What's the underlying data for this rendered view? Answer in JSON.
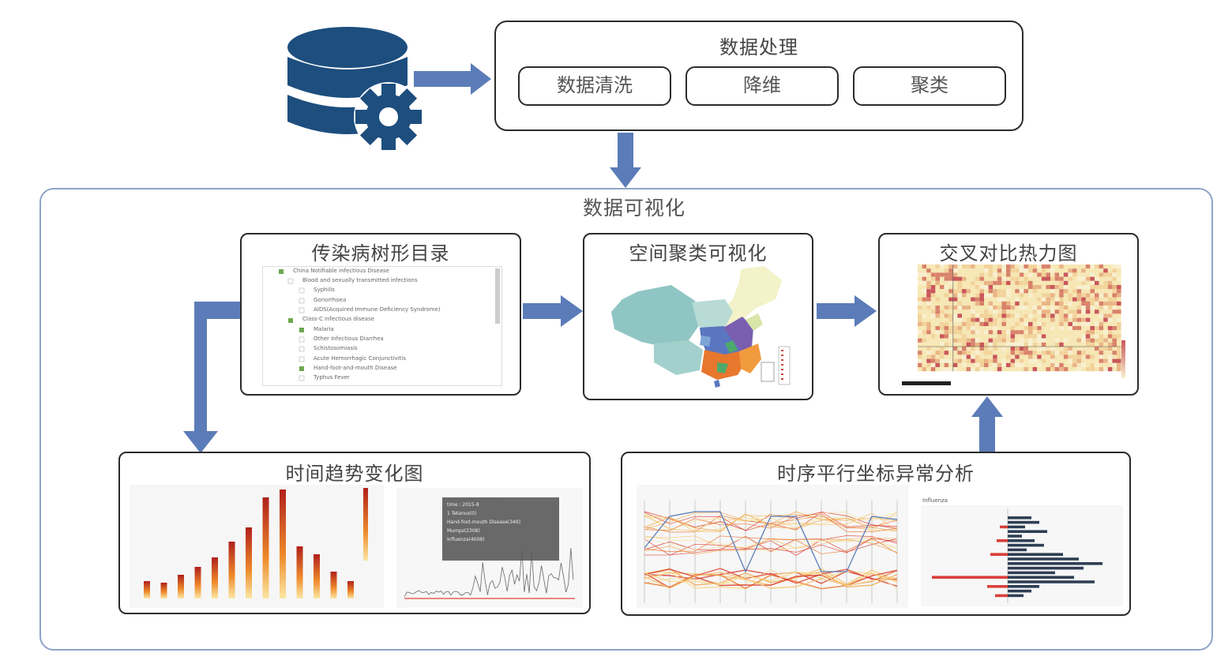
{
  "top": {
    "process_title": "数据处理",
    "steps": [
      "数据清洗",
      "降维",
      "聚类"
    ]
  },
  "visualization": {
    "title": "数据可视化",
    "panels": {
      "tree": "传染病树形目录",
      "map": "空间聚类可视化",
      "heatmap": "交叉对比热力图",
      "trend": "时间趋势变化图",
      "parallel": "时序平行坐标异常分析"
    }
  },
  "tree_items": [
    "China Notifiable Infectious Disease",
    "Blood and sexually transmitted infections",
    "Syphilis",
    "Gonorrhoea",
    "AIDS(Acquired Immune Deficiency Syndrome)",
    "Class-C infectious disease",
    "Malaria",
    "Other Infectious Diarrhea",
    "Schistosomiasis",
    "Acute Hemorrhagic Conjunctivitis",
    "Hand-foot-and-mouth Disease",
    "Typhus Fever"
  ],
  "tooltip": {
    "date": "time : 2015-8",
    "lines": [
      "1 Tetanus(0)",
      "Hand-foot-mouth Disease(349)",
      "Mumps(2308)",
      "Influenza(4008)"
    ]
  },
  "parallel_side_title": "Influenza",
  "colors": {
    "arrow": "#5b7cb8",
    "icon": "#1d4e7e",
    "outline": "#8ea3c8"
  },
  "icons": [
    "database-gear-icon"
  ]
}
